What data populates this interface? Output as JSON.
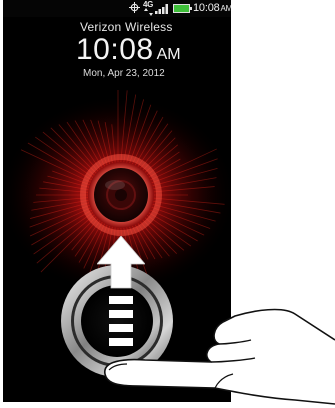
{
  "status_bar": {
    "network_label": "4G",
    "time": "10:08",
    "time_ampm": "AM",
    "icons": [
      "gps-icon",
      "data-arrows-icon",
      "signal-icon",
      "battery-icon"
    ]
  },
  "lock_screen": {
    "carrier": "Verizon Wireless",
    "clock_time": "10:08",
    "clock_ampm": "AM",
    "date": "Mon, Apr 23, 2012"
  },
  "colors": {
    "background": "#000000",
    "accent_red": "#d81b1b",
    "battery_green": "#3fbf3a"
  }
}
